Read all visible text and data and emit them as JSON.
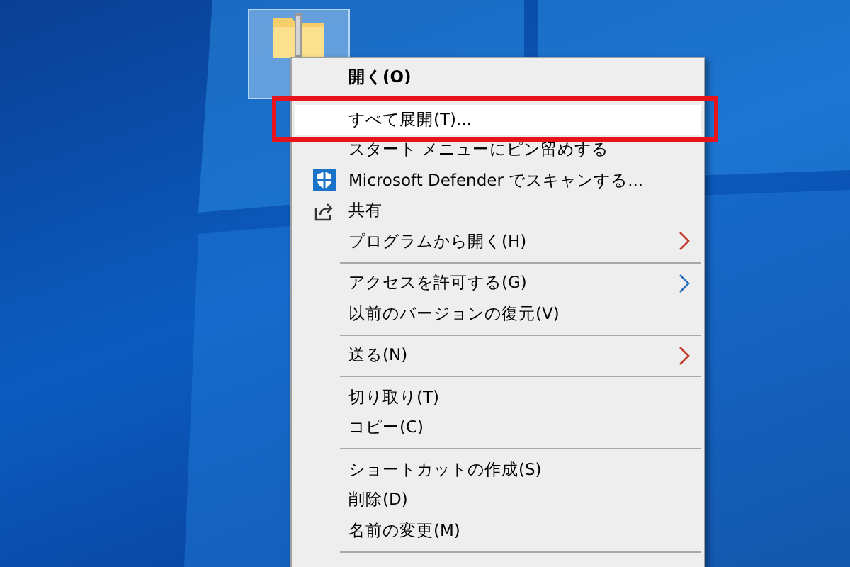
{
  "desktop": {
    "icon": {
      "selected": true
    }
  },
  "context_menu": {
    "items": [
      {
        "kind": "item",
        "label": "開く(O)",
        "bold": true,
        "selected": false
      },
      {
        "kind": "separator"
      },
      {
        "kind": "item",
        "label": "すべて展開(T)...",
        "selected": true,
        "highlight_frame": true
      },
      {
        "kind": "item",
        "label": "スタート メニューにピン留めする",
        "selected": false
      },
      {
        "kind": "shield",
        "label": "Microsoft Defender でスキャンする...",
        "selected": false
      },
      {
        "kind": "share",
        "label": "共有",
        "selected": false
      },
      {
        "kind": "item",
        "label": "プログラムから開く(H)",
        "submenu": true,
        "color": "#c0392b",
        "selected": false
      },
      {
        "kind": "separator"
      },
      {
        "kind": "item",
        "label": "アクセスを許可する(G)",
        "submenu": true,
        "color": "#2b6cc0",
        "selected": false
      },
      {
        "kind": "item",
        "label": "以前のバージョンの復元(V)",
        "selected": false
      },
      {
        "kind": "separator"
      },
      {
        "kind": "item",
        "label": "送る(N)",
        "submenu": true,
        "color": "#c0392b",
        "selected": false
      },
      {
        "kind": "separator"
      },
      {
        "kind": "item",
        "label": "切り取り(T)",
        "selected": false
      },
      {
        "kind": "item",
        "label": "コピー(C)",
        "selected": false
      },
      {
        "kind": "separator"
      },
      {
        "kind": "item",
        "label": "ショートカットの作成(S)",
        "selected": false
      },
      {
        "kind": "item",
        "label": "削除(D)",
        "selected": false
      },
      {
        "kind": "item",
        "label": "名前の変更(M)",
        "selected": false
      },
      {
        "kind": "separator"
      }
    ]
  }
}
